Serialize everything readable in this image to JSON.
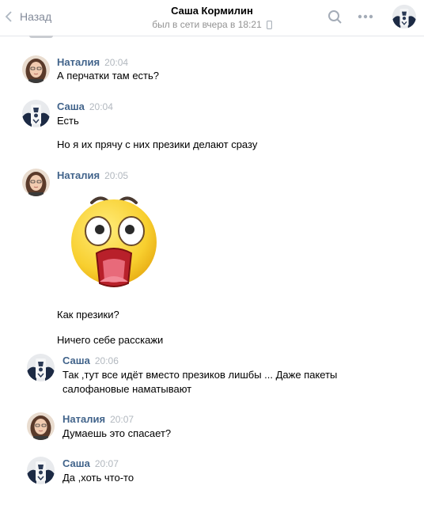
{
  "header": {
    "back_label": "Назад",
    "chat_title": "Саша Кормилин",
    "status": "был в сети вчера в 18:21",
    "icons": [
      "chevron-left-icon",
      "mobile-icon",
      "search-icon",
      "more-icon"
    ]
  },
  "messages": [
    {
      "author": "Наталия",
      "time": "20:04",
      "lines": [
        "А перчатки там есть?"
      ]
    },
    {
      "author": "Саша",
      "time": "20:04",
      "lines": [
        "Есть",
        "Но я их прячу с них презики делают сразу"
      ]
    },
    {
      "author": "Наталия",
      "time": "20:05",
      "sticker": "shocked-emoji-sticker",
      "lines": [
        "Как презики?",
        "Ничего себе расскажи"
      ]
    },
    {
      "author": "Саша",
      "time": "20:06",
      "lines": [
        "Так ,тут все идёт вместо презиков лишбы ... Даже пакеты",
        "салофановые наматывают"
      ]
    },
    {
      "author": "Наталия",
      "time": "20:07",
      "lines": [
        "Думаешь это спасает?"
      ]
    },
    {
      "author": "Саша",
      "time": "20:07",
      "lines": [
        "Да ,хоть что-то"
      ]
    }
  ],
  "colors": {
    "author_link": "#42648b",
    "muted": "#939393",
    "timestamp": "#b2b8bf",
    "divider": "#e4e6ea"
  }
}
